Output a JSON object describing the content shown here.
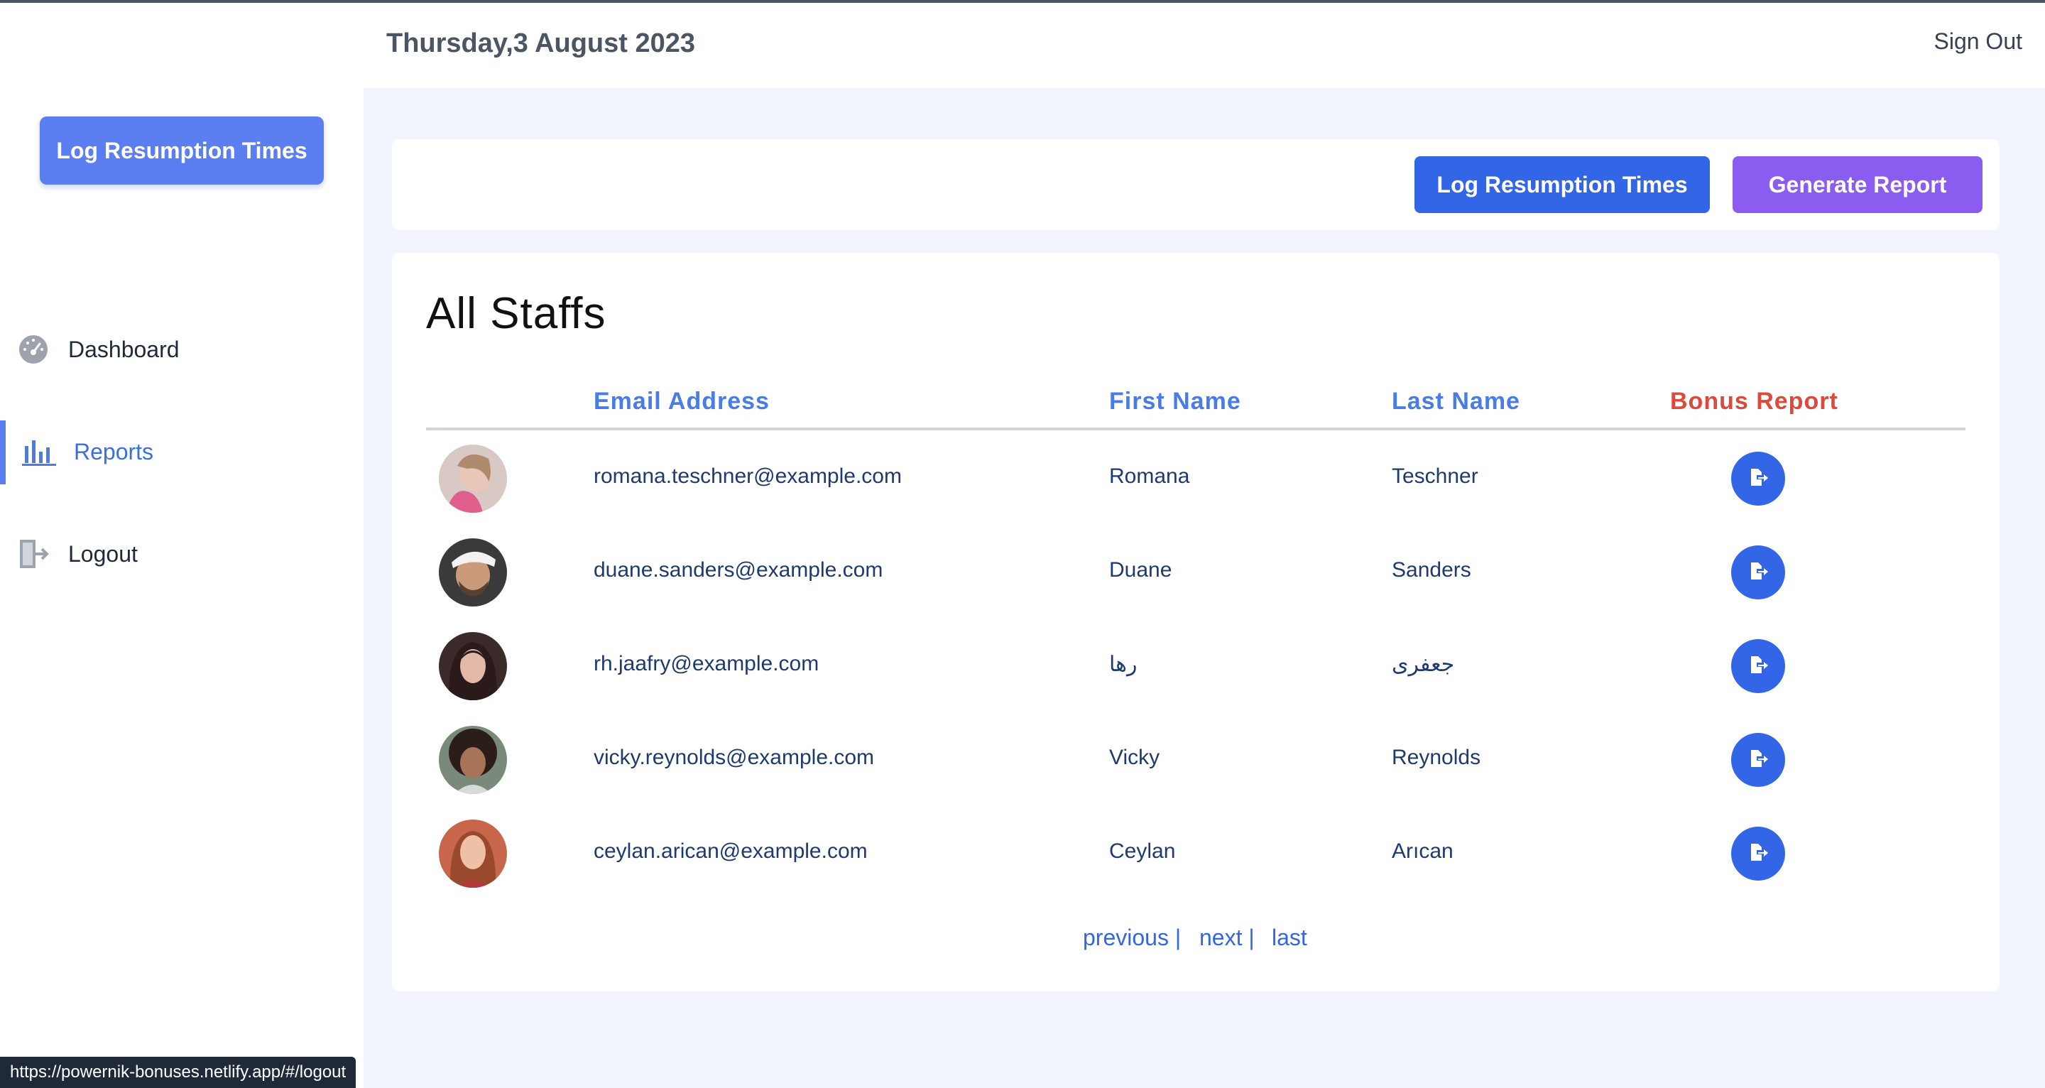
{
  "header": {
    "date": "Thursday,3 August 2023",
    "sign_out": "Sign Out"
  },
  "sidebar": {
    "cta_label": "Log Resumption Times",
    "items": [
      {
        "label": "Dashboard",
        "icon": "speedometer-icon",
        "active": false
      },
      {
        "label": "Reports",
        "icon": "bar-chart-icon",
        "active": true
      },
      {
        "label": "Logout",
        "icon": "logout-door-icon",
        "active": false
      }
    ]
  },
  "actions": {
    "log_label": "Log Resumption Times",
    "generate_label": "Generate Report"
  },
  "table": {
    "title": "All Staffs",
    "columns": [
      "Email Address",
      "First Name",
      "Last Name",
      "Bonus Report"
    ],
    "rows": [
      {
        "email": "romana.teschner@example.com",
        "first": "Romana",
        "last": "Teschner"
      },
      {
        "email": "duane.sanders@example.com",
        "first": "Duane",
        "last": "Sanders"
      },
      {
        "email": "rh.jaafry@example.com",
        "first": "رها",
        "last": "جعفری"
      },
      {
        "email": "vicky.reynolds@example.com",
        "first": "Vicky",
        "last": "Reynolds"
      },
      {
        "email": "ceylan.arican@example.com",
        "first": "Ceylan",
        "last": "Arıcan"
      }
    ],
    "row_action_icon": "export-document-icon"
  },
  "pagination": {
    "previous": "previous |",
    "next": "next |",
    "last": "last"
  },
  "status_url": "https://powernik-bonuses.netlify.app/#/logout",
  "colors": {
    "primary": "#3366e6",
    "accent_purple": "#8a5cf0",
    "bonus_header": "#dc4a3c",
    "background": "#f1f4fd"
  }
}
